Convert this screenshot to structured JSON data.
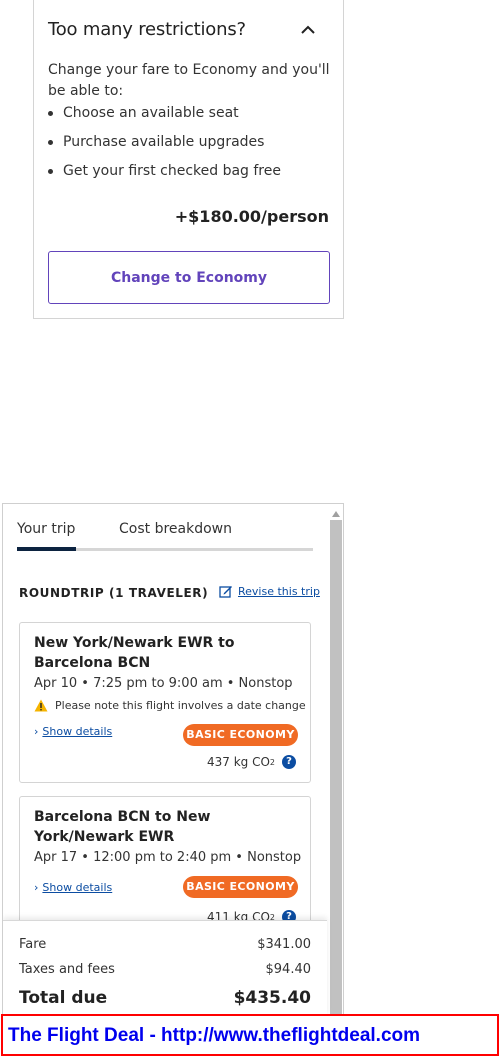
{
  "upsell": {
    "title": "Too many restrictions?",
    "description": "Change your fare to Economy and you'll be able to:",
    "benefits": [
      "Choose an available seat",
      "Purchase available upgrades",
      "Get your first checked bag free"
    ],
    "price": "+$180.00/person",
    "button_label": "Change to Economy"
  },
  "trip": {
    "tabs": [
      {
        "label": "Your trip",
        "active": true
      },
      {
        "label": "Cost breakdown",
        "active": false
      }
    ],
    "heading": "ROUNDTRIP (1 TRAVELER)",
    "revise_label": "Revise this trip",
    "segments": [
      {
        "route": "New York/Newark EWR to Barcelona BCN",
        "time": "Apr 10 • 7:25 pm to 9:00 am • Nonstop",
        "notice": "Please note this flight involves a date change",
        "details_label": "Show details",
        "fare_badge": "BASIC ECONOMY",
        "co2": "437 kg CO",
        "co2_sub": "2"
      },
      {
        "route": "Barcelona BCN to New York/Newark EWR",
        "time": "Apr 17 • 12:00 pm to 2:40 pm • Nonstop",
        "details_label": "Show details",
        "fare_badge": "BASIC ECONOMY",
        "co2": "411 kg CO",
        "co2_sub": "2"
      }
    ],
    "totals": {
      "fare_label": "Fare",
      "fare_value": "$341.00",
      "taxes_label": "Taxes and fees",
      "taxes_value": "$94.40",
      "total_label": "Total due",
      "total_value": "$435.40"
    }
  },
  "banner": {
    "text": "The Flight Deal - http://www.theflightdeal.com"
  },
  "colors": {
    "accent_purple": "#6244bb",
    "badge_orange": "#f06a24",
    "link_blue": "#0c4da2",
    "tab_active": "#0c2340",
    "banner_border": "#ff0000",
    "banner_text": "#0000ee"
  },
  "icons": {
    "collapse": "chevron-up-icon",
    "revise": "edit-icon",
    "notice": "warning-icon",
    "details": "chevron-right-icon",
    "co2_help": "question-icon"
  }
}
